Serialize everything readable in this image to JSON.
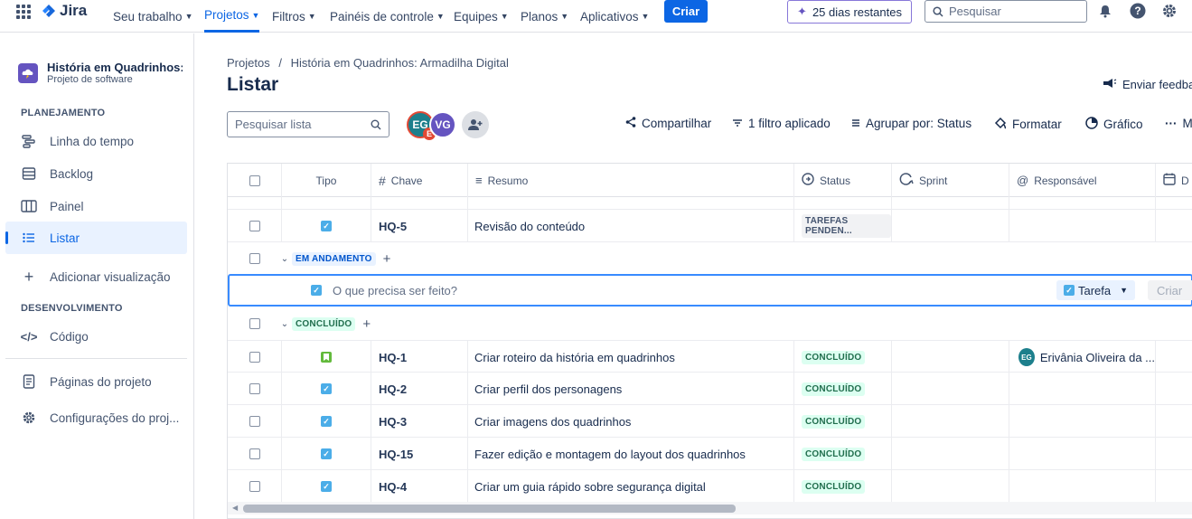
{
  "topbar": {
    "logo": "Jira",
    "nav": [
      {
        "label": "Seu trabalho"
      },
      {
        "label": "Projetos"
      },
      {
        "label": "Filtros"
      },
      {
        "label": "Painéis de controle"
      },
      {
        "label": "Equipes"
      },
      {
        "label": "Planos"
      },
      {
        "label": "Aplicativos"
      }
    ],
    "create_label": "Criar",
    "trial_label": "25 dias restantes",
    "search_placeholder": "Pesquisar"
  },
  "sidebar": {
    "project_name": "História em Quadrinhos:...",
    "project_type": "Projeto de software",
    "planning_heading": "PLANEJAMENTO",
    "items": [
      {
        "label": "Linha do tempo"
      },
      {
        "label": "Backlog"
      },
      {
        "label": "Painel"
      },
      {
        "label": "Listar"
      }
    ],
    "add_view": "Adicionar visualização",
    "dev_heading": "DESENVOLVIMENTO",
    "code": "Código",
    "pages": "Páginas do projeto",
    "settings": "Configurações do proj..."
  },
  "main": {
    "breadcrumb_root": "Projetos",
    "breadcrumb_sep": "/",
    "breadcrumb_project": "História em Quadrinhos: Armadilha Digital",
    "title": "Listar",
    "feedback": "Enviar feedba",
    "search_placeholder": "Pesquisar lista",
    "avatars": [
      {
        "initials": "EG",
        "badge": "E",
        "color": "#1d7f8c"
      },
      {
        "initials": "VG",
        "color": "#6554c0"
      }
    ],
    "toolbar": {
      "share": "Compartilhar",
      "filter": "1 filtro aplicado",
      "group": "Agrupar por: Status",
      "format": "Formatar",
      "chart": "Gráfico",
      "more": "Ma"
    }
  },
  "table": {
    "headers": {
      "type": "Tipo",
      "key": "Chave",
      "summary": "Resumo",
      "status": "Status",
      "sprint": "Sprint",
      "assignee": "Responsável",
      "date": "D"
    },
    "todo_row": {
      "key": "HQ-5",
      "summary": "Revisão do conteúdo",
      "status": "TAREFAS PENDEN..."
    },
    "group_progress": "EM ANDAMENTO",
    "create_placeholder": "O que precisa ser feito?",
    "create_type": "Tarefa",
    "create_button": "Criar",
    "group_done": "CONCLUÍDO",
    "done_rows": [
      {
        "key": "HQ-1",
        "summary": "Criar roteiro da história em quadrinhos",
        "status": "CONCLUÍDO",
        "assignee": "Erivânia Oliveira da ...",
        "assignee_initials": "EG",
        "type": "story"
      },
      {
        "key": "HQ-2",
        "summary": "Criar perfil dos personagens",
        "status": "CONCLUÍDO",
        "assignee": "",
        "type": "task"
      },
      {
        "key": "HQ-3",
        "summary": "Criar imagens dos quadrinhos",
        "status": "CONCLUÍDO",
        "assignee": "",
        "type": "task"
      },
      {
        "key": "HQ-15",
        "summary": "Fazer edição e montagem do layout dos quadrinhos",
        "status": "CONCLUÍDO",
        "assignee": "",
        "type": "task"
      },
      {
        "key": "HQ-4",
        "summary": "Criar um guia rápido sobre segurança digital",
        "status": "CONCLUÍDO",
        "assignee": "",
        "type": "task"
      }
    ]
  }
}
